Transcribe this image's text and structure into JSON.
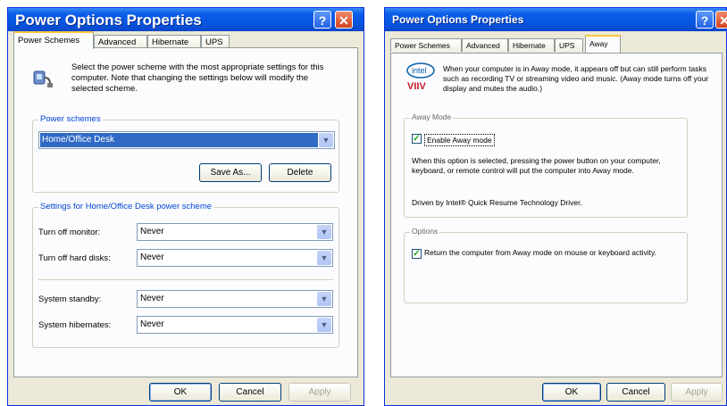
{
  "left": {
    "title": "Power Options Properties",
    "tabs": [
      "Power Schemes",
      "Advanced",
      "Hibernate",
      "UPS"
    ],
    "intro": "Select the power scheme with the most appropriate settings for this computer. Note that changing the settings below will modify the selected scheme.",
    "schemes_group": "Power schemes",
    "scheme_value": "Home/Office Desk",
    "save_as": "Save As...",
    "delete": "Delete",
    "settings_group": "Settings for Home/Office Desk power scheme",
    "settings": [
      {
        "label": "Turn off monitor:",
        "value": "Never"
      },
      {
        "label": "Turn off hard disks:",
        "value": "Never"
      },
      {
        "label": "System standby:",
        "value": "Never"
      },
      {
        "label": "System hibernates:",
        "value": "Never"
      }
    ],
    "ok": "OK",
    "cancel": "Cancel",
    "apply": "Apply"
  },
  "right": {
    "title": "Power Options Properties",
    "tabs": [
      "Power Schemes",
      "Advanced",
      "Hibernate",
      "UPS",
      "Away"
    ],
    "intro": "When your computer is in Away mode, it appears off but can still perform tasks such as recording TV or streaming video and music. (Away mode turns off your display and mutes the audio.)",
    "logo_intel": "intel",
    "logo_viiv": "VIIV",
    "away_group": "Away Mode",
    "enable_label": "Enable Away mode",
    "enable_desc": "When this option is selected, pressing the power button on your computer, keyboard, or remote control will put the computer into Away mode.",
    "driver_text": "Driven by Intel® Quick Resume Technology Driver.",
    "options_group": "Options",
    "return_label": "Return the computer from Away mode on mouse or keyboard activity.",
    "ok": "OK",
    "cancel": "Cancel",
    "apply": "Apply"
  }
}
